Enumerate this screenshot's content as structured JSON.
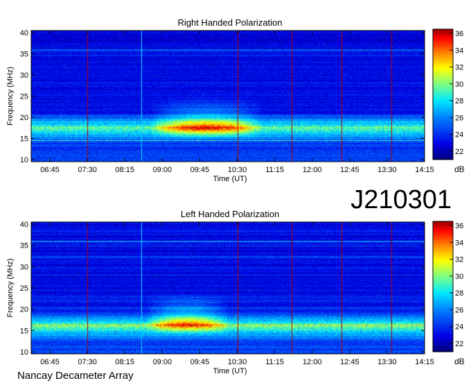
{
  "observation_id": "J210301",
  "credit": "Nancay Decameter Array",
  "chart_data": [
    {
      "type": "heatmap",
      "title": "Right Handed Polarization",
      "xlabel": "Time (UT)",
      "ylabel": "Frequency (MHz)",
      "x_ticks": [
        "06:45",
        "07:30",
        "08:15",
        "09:00",
        "09:45",
        "10:30",
        "11:15",
        "12:00",
        "12:45",
        "13:30",
        "14:15"
      ],
      "y_ticks": [
        10,
        15,
        20,
        25,
        30,
        35,
        40
      ],
      "ylim": [
        9.5,
        40.5
      ],
      "colorbar": {
        "label": "dB",
        "ticks": [
          22,
          24,
          26,
          28,
          30,
          32,
          34,
          36
        ],
        "range": [
          21,
          36.5
        ]
      },
      "background_level_db": 23,
      "features": [
        {
          "kind": "emission_band",
          "freq_mhz": 17.5,
          "time_from": "06:20",
          "time_to": "14:15",
          "level_db": 29
        },
        {
          "kind": "emission_peak",
          "freq_mhz": 17.5,
          "time_from": "08:45",
          "time_to": "11:00",
          "level_db": 34
        },
        {
          "kind": "rfi_line",
          "freq_mhz": 36,
          "level_db": 26
        },
        {
          "kind": "vertical_line",
          "time": "07:30",
          "color": "#b00000"
        },
        {
          "kind": "vertical_line",
          "time": "08:35",
          "color": "#00e0ff"
        },
        {
          "kind": "vertical_line",
          "time": "10:30",
          "color": "#b00000"
        },
        {
          "kind": "vertical_line",
          "time": "11:35",
          "color": "#b00000"
        },
        {
          "kind": "vertical_line",
          "time": "12:35",
          "color": "#b00000"
        },
        {
          "kind": "vertical_line",
          "time": "13:35",
          "color": "#b00000"
        }
      ]
    },
    {
      "type": "heatmap",
      "title": "Left Handed Polarization",
      "xlabel": "Time (UT)",
      "ylabel": "Frequency (MHz)",
      "x_ticks": [
        "06:45",
        "07:30",
        "08:15",
        "09:00",
        "09:45",
        "10:30",
        "11:15",
        "12:00",
        "12:45",
        "13:30",
        "14:15"
      ],
      "y_ticks": [
        10,
        15,
        20,
        25,
        30,
        35,
        40
      ],
      "ylim": [
        9.5,
        40.5
      ],
      "colorbar": {
        "label": "dB",
        "ticks": [
          22,
          24,
          26,
          28,
          30,
          32,
          34,
          36
        ],
        "range": [
          21,
          36.5
        ]
      },
      "background_level_db": 23,
      "features": [
        {
          "kind": "emission_band",
          "freq_mhz": 16,
          "time_from": "06:20",
          "time_to": "14:15",
          "level_db": 29
        },
        {
          "kind": "emission_peak",
          "freq_mhz": 16.5,
          "time_from": "08:40",
          "time_to": "10:20",
          "level_db": 33
        },
        {
          "kind": "rfi_line",
          "freq_mhz": 36,
          "level_db": 26
        },
        {
          "kind": "vertical_line",
          "time": "07:30",
          "color": "#b00000"
        },
        {
          "kind": "vertical_line",
          "time": "08:35",
          "color": "#00e0ff"
        },
        {
          "kind": "vertical_line",
          "time": "10:30",
          "color": "#b00000"
        },
        {
          "kind": "vertical_line",
          "time": "11:35",
          "color": "#b00000"
        },
        {
          "kind": "vertical_line",
          "time": "12:35",
          "color": "#b00000"
        },
        {
          "kind": "vertical_line",
          "time": "13:35",
          "color": "#b00000"
        }
      ]
    }
  ]
}
